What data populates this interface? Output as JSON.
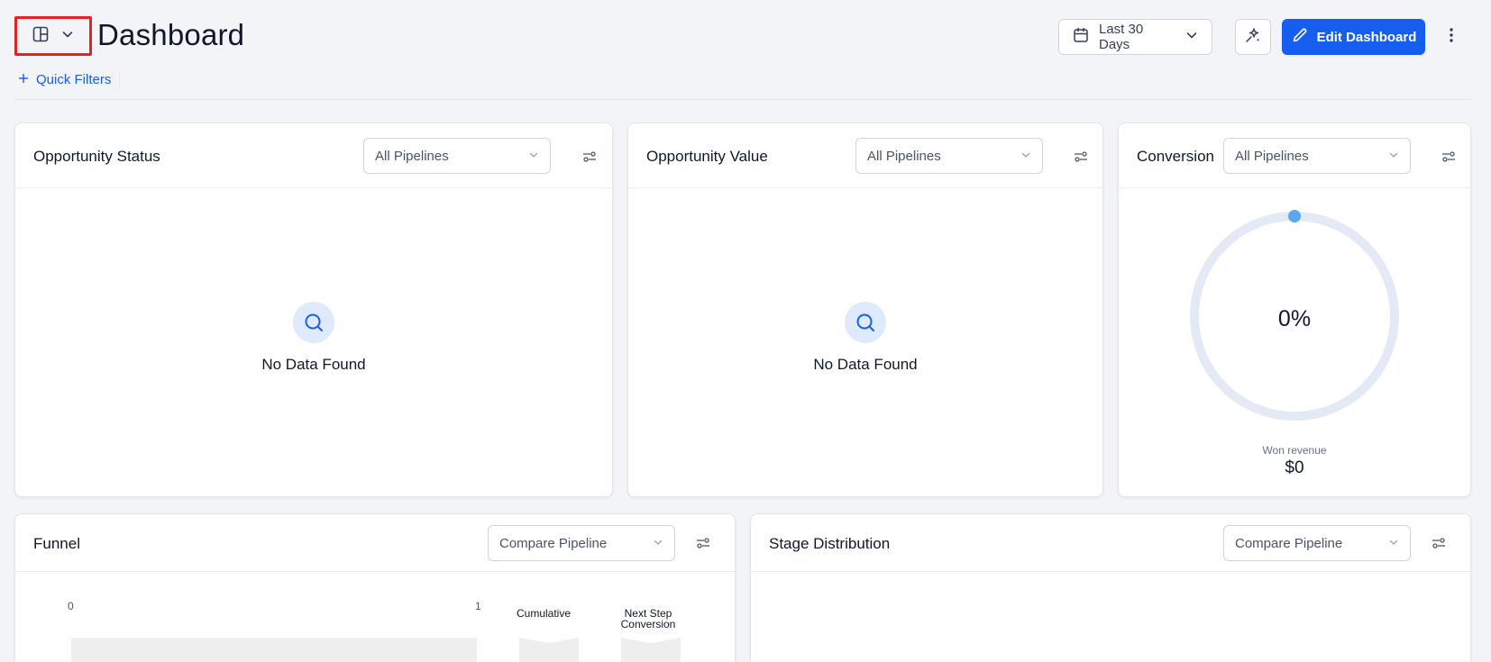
{
  "header": {
    "title": "Dashboard",
    "date_range_label": "Last 30 Days",
    "edit_label": "Edit Dashboard",
    "quick_filters_label": "Quick Filters"
  },
  "colors": {
    "accent": "#155eef",
    "highlight_border": "#e02424",
    "gauge_track": "#e3eaf6",
    "gauge_dot": "#5aa9f0"
  },
  "cards": {
    "opportunity_status": {
      "title": "Opportunity Status",
      "select_value": "All Pipelines",
      "empty_text": "No Data Found"
    },
    "opportunity_value": {
      "title": "Opportunity Value",
      "select_value": "All Pipelines",
      "empty_text": "No Data Found"
    },
    "conversion": {
      "title": "Conversion",
      "select_value": "All Pipelines",
      "percent": "0%",
      "won_label": "Won revenue",
      "won_value": "$0",
      "fill_fraction": 0
    },
    "funnel": {
      "title": "Funnel",
      "select_value": "Compare Pipeline",
      "axis_min": "0",
      "axis_max": "1",
      "col1_label": "Cumulative",
      "col2_label_line1": "Next Step",
      "col2_label_line2": "Conversion"
    },
    "stage_distribution": {
      "title": "Stage Distribution",
      "select_value": "Compare Pipeline"
    }
  },
  "icons": [
    "layout-icon",
    "chevron-down-icon",
    "calendar-icon",
    "sparkle-icon",
    "pencil-icon",
    "kebab-icon",
    "plus-icon",
    "filter-settings-icon",
    "search-icon"
  ]
}
